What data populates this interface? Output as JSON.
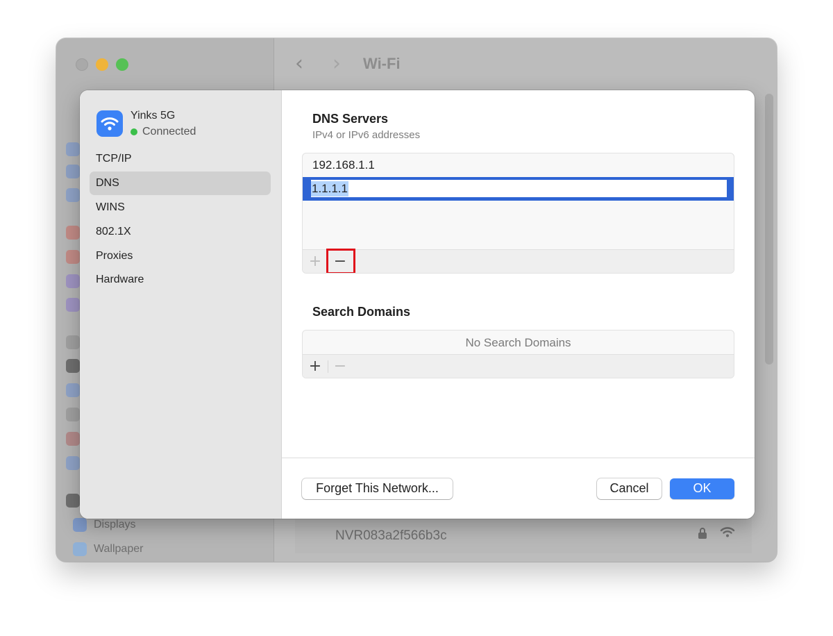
{
  "window": {
    "title": "Wi-Fi",
    "sidebar_items": [
      {
        "label": "Displays"
      },
      {
        "label": "Wallpaper"
      }
    ],
    "network_row": "NVR083a2f566b3c"
  },
  "dialog": {
    "network": {
      "name": "Yinks 5G",
      "status": "Connected"
    },
    "sidebar": {
      "items": [
        {
          "label": "TCP/IP"
        },
        {
          "label": "DNS"
        },
        {
          "label": "WINS"
        },
        {
          "label": "802.1X"
        },
        {
          "label": "Proxies"
        },
        {
          "label": "Hardware"
        }
      ],
      "selected": "DNS"
    },
    "dns": {
      "title": "DNS Servers",
      "subtitle": "IPv4 or IPv6 addresses",
      "servers": [
        "192.168.1.1",
        "1.1.1.1"
      ],
      "editing_value": "1.1.1.1",
      "add_symbol": "+",
      "remove_symbol": "−"
    },
    "search_domains": {
      "title": "Search Domains",
      "empty_text": "No Search Domains",
      "add_symbol": "+",
      "remove_symbol": "−"
    },
    "footer": {
      "forget_label": "Forget This Network...",
      "cancel_label": "Cancel",
      "ok_label": "OK"
    }
  },
  "colors": {
    "accent": "#3b82f6",
    "selection": "#2e64d4",
    "status_green": "#3bbf4a",
    "highlight_red": "#e0101a"
  }
}
